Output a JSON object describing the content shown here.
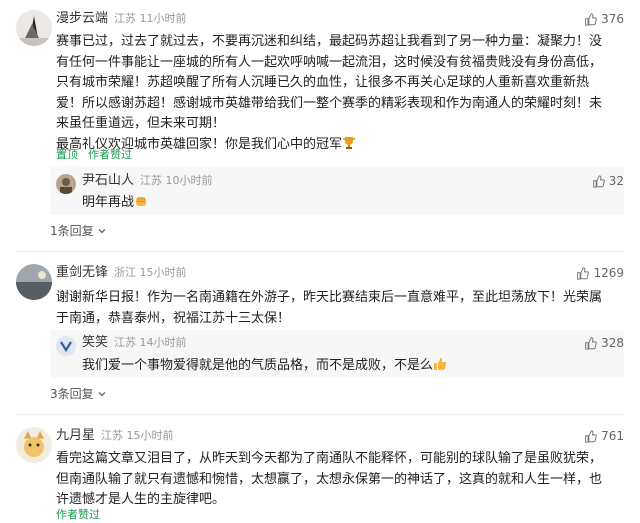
{
  "comments": [
    {
      "user": "漫步云端",
      "meta": "江苏 11小时前",
      "likes": "376",
      "text_lines": [
        "赛事已过，过去了就过去，不要再沉迷和纠结，最起码苏超让我看到了另一种力量：凝聚力！没",
        "有任何一件事能让一座城的所有人一起欢呼呐喊一起流泪，这时候没有贫福贵贱没有身份高低，",
        "只有城市荣耀！苏超唤醒了所有人沉睡已久的血性，让很多不再关心足球的人重新喜欢重新热",
        "爱！所以感谢苏超！感谢城市英雄带给我们一整个赛季的精彩表现和作为南通人的荣耀时刻！未",
        "来虽任重道远，但未来可期！",
        "最高礼仪欢迎城市英雄回家！你是我们心中的冠军"
      ],
      "actions": [
        "置顶",
        "作者赞过"
      ],
      "reply": {
        "user": "尹石山人",
        "meta": "江苏 10小时前",
        "likes": "32",
        "text": "明年再战"
      },
      "more_replies": "1条回复"
    },
    {
      "user": "重剑无锋",
      "meta": "浙江 15小时前",
      "likes": "1269",
      "text_lines": [
        "谢谢新华日报！作为一名南通籍在外游子，昨天比赛结束后一直意难平，至此坦荡放下！光荣属",
        "于南通，恭喜泰州，祝福江苏十三太保！"
      ],
      "reply": {
        "user": "笑笑",
        "meta": "江苏 14小时前",
        "likes": "328",
        "text": "我们爱一个事物爱得就是他的气质品格，而不是成败，不是么"
      },
      "more_replies": "3条回复"
    },
    {
      "user": "九月星",
      "meta": "江苏 15小时前",
      "likes": "761",
      "text_lines": [
        "看完这篇文章又泪目了，从昨天到今天都为了南通队不能释怀，可能别的球队输了是虽败犹荣，",
        "但南通队输了就只有遗憾和惋惜，太想赢了，太想永保第一的神话了，这真的就和人生一样，也",
        "许遗憾才是人生的主旋律吧。"
      ],
      "actions": [
        "作者赞过"
      ]
    }
  ],
  "icons": {
    "like": "thumb-up-icon",
    "chevron": "chevron-down-icon",
    "trophy": "trophy-emoji",
    "fist": "fist-emoji",
    "thumb": "thumbs-up-emoji"
  },
  "colors": {
    "accent": "#1a9c4e",
    "meta": "#9a9a9a"
  }
}
